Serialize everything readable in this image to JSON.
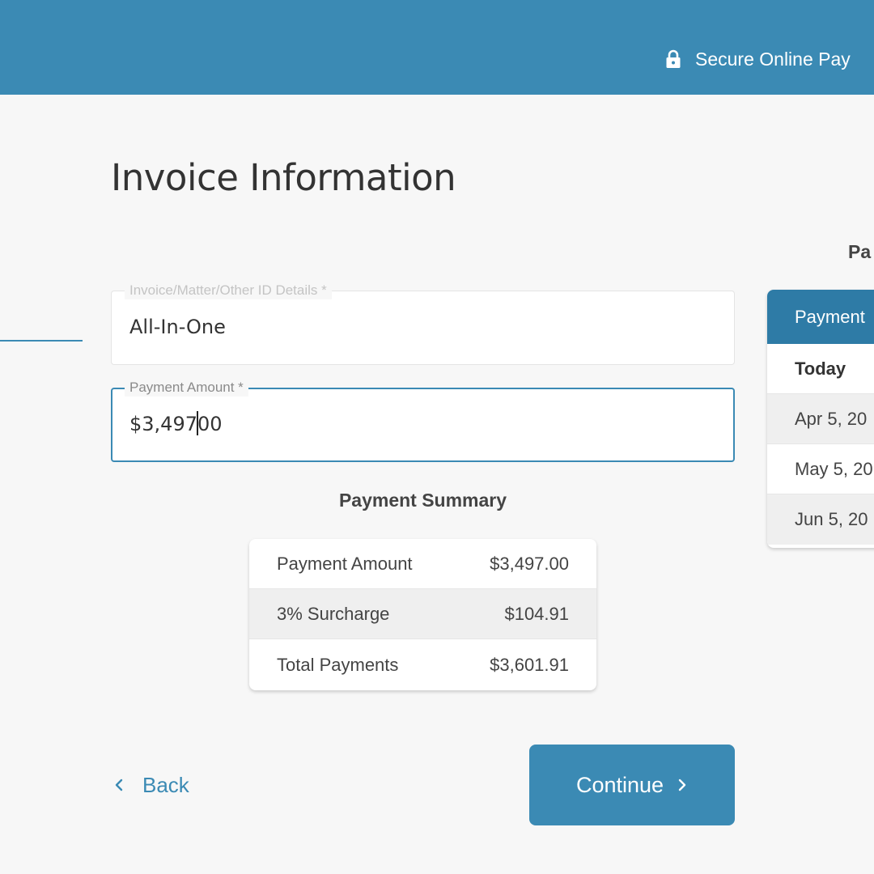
{
  "header": {
    "secure_text": "Secure Online Pay"
  },
  "page_title": "Invoice Information",
  "fields": {
    "invoice_id": {
      "label": "Invoice/Matter/Other ID Details *",
      "value": "All-In-One"
    },
    "payment_amount": {
      "label": "Payment Amount *",
      "value_before_caret": "$3,497",
      "value_after_caret": "00"
    }
  },
  "summary": {
    "title": "Payment Summary",
    "rows": [
      {
        "label": "Payment Amount",
        "value": "$3,497.00"
      },
      {
        "label": "3% Surcharge",
        "value": "$104.91"
      },
      {
        "label": "Total Payments",
        "value": "$3,601.91"
      }
    ]
  },
  "nav": {
    "back_label": "Back",
    "continue_label": "Continue"
  },
  "schedule": {
    "heading": "Pa",
    "header_label": "Payment",
    "rows": [
      "Today",
      "Apr 5, 20",
      "May 5, 20",
      "Jun 5, 20"
    ]
  },
  "colors": {
    "accent": "#3b8ab4",
    "accent_dark": "#2e7ba6",
    "background": "#f7f7f7"
  }
}
